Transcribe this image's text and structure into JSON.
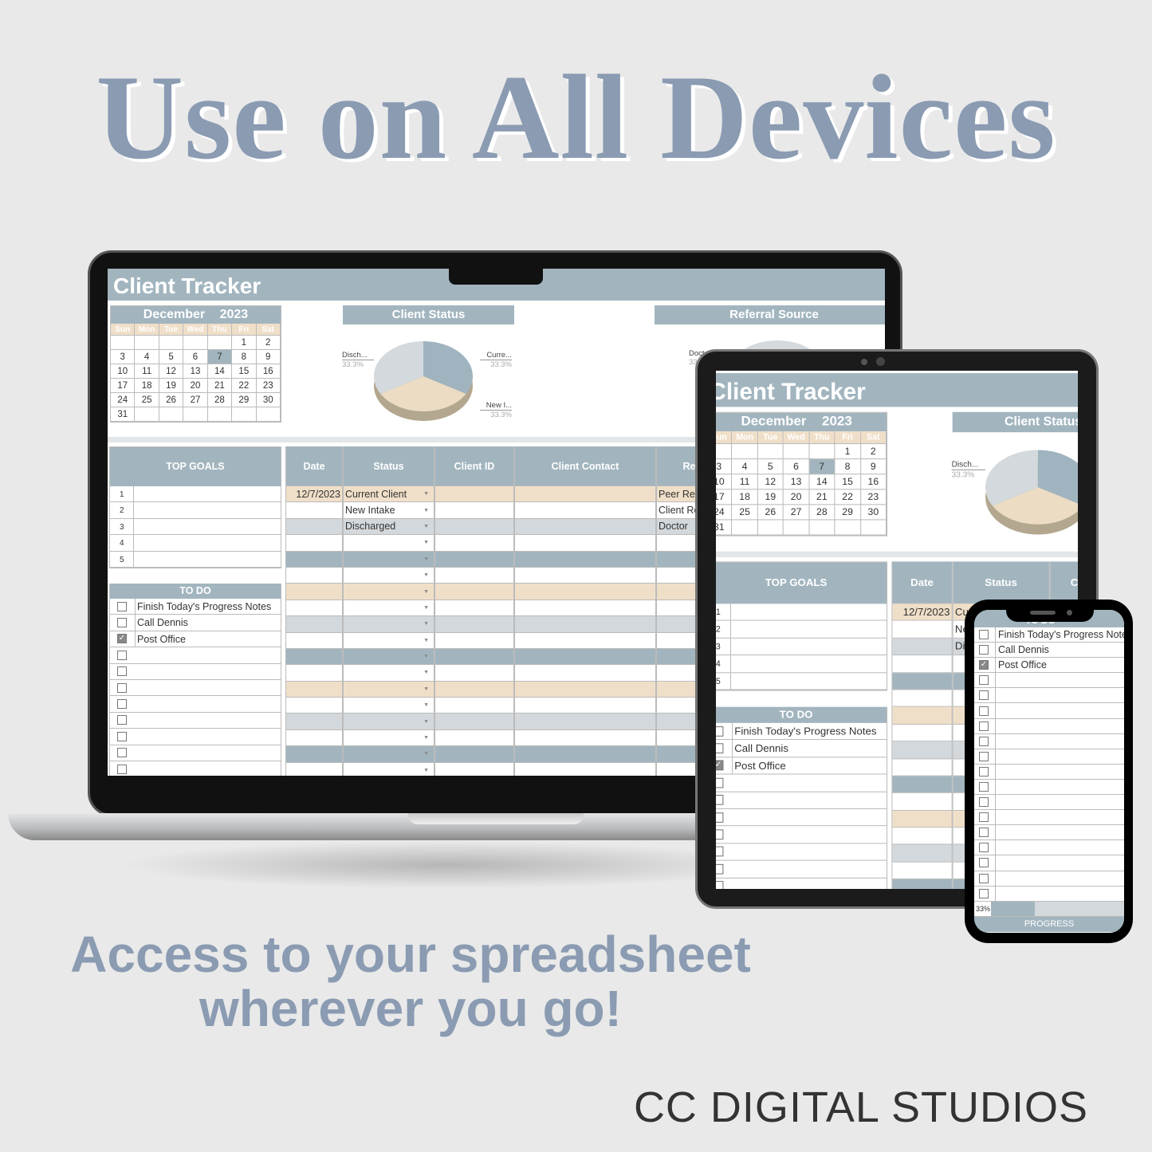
{
  "headline": "Use on All Devices",
  "subtitle": [
    "Access to your spreadsheet",
    "wherever you go!"
  ],
  "brand": "CC DIGITAL STUDIOS",
  "colors": {
    "accent": "#a2b5bf",
    "beige": "#f0dfc8",
    "gray": "#d3d8dc",
    "headline": "#8a9bb2"
  },
  "sheet": {
    "title": "Client Tracker",
    "calendar": {
      "month": "December",
      "year": "2023",
      "days": [
        "Sun",
        "Mon",
        "Tue",
        "Wed",
        "Thu",
        "Fri",
        "Sat"
      ],
      "weeks": [
        [
          "",
          "",
          "",
          "",
          "",
          "1",
          "2"
        ],
        [
          "3",
          "4",
          "5",
          "6",
          "7",
          "8",
          "9"
        ],
        [
          "10",
          "11",
          "12",
          "13",
          "14",
          "15",
          "16"
        ],
        [
          "17",
          "18",
          "19",
          "20",
          "21",
          "22",
          "23"
        ],
        [
          "24",
          "25",
          "26",
          "27",
          "28",
          "29",
          "30"
        ],
        [
          "31",
          "",
          "",
          "",
          "",
          "",
          ""
        ]
      ],
      "today": "7"
    },
    "client_status": {
      "title": "Client Status",
      "slices": [
        {
          "label": "Curre...",
          "pct": "33.3%",
          "value": 33.3,
          "color": "#9fb4bf"
        },
        {
          "label": "New I...",
          "pct": "33.3%",
          "value": 33.3,
          "color": "#ecdcc4"
        },
        {
          "label": "Disch...",
          "pct": "33.3%",
          "value": 33.3,
          "color": "#d3d9dd"
        }
      ]
    },
    "referral_source": {
      "title": "Referral Source",
      "label": "Docto...",
      "pct": "33.3%"
    },
    "top_goals": {
      "header": "TOP GOALS",
      "numbers": [
        "1",
        "2",
        "3",
        "4",
        "5"
      ]
    },
    "todo": {
      "header": "TO DO",
      "items": [
        {
          "text": "Finish Today's Progress Notes",
          "checked": false
        },
        {
          "text": "Call Dennis",
          "checked": false
        },
        {
          "text": "Post Office",
          "checked": true
        }
      ],
      "progress_percent": 33,
      "progress_text": "33%",
      "progress_label": "PROGRESS"
    },
    "table": {
      "headers": [
        "Date",
        "Status",
        "Client ID",
        "Client Contact",
        "Referral Source"
      ],
      "rows": [
        [
          "12/7/2023",
          "Current Client",
          "",
          "",
          "Peer Referral"
        ],
        [
          "",
          "New Intake",
          "",
          "",
          "Client Referral"
        ],
        [
          "",
          "Discharged",
          "",
          "",
          "Doctor"
        ]
      ]
    }
  }
}
